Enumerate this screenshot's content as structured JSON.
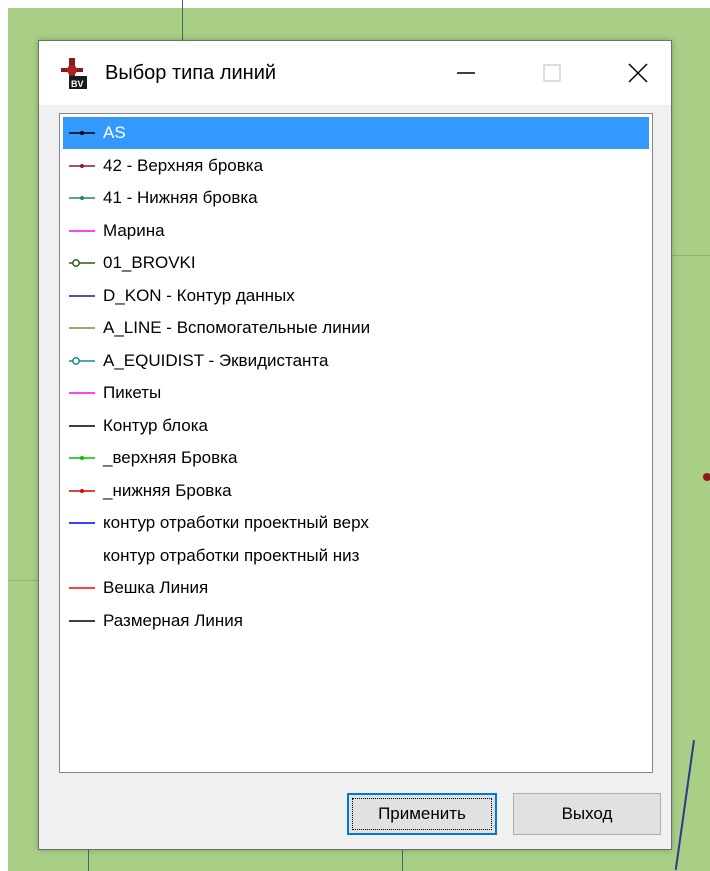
{
  "window": {
    "title": "Выбор типа линий",
    "app_icon_label": "BV"
  },
  "list": {
    "items": [
      {
        "label": "AS",
        "color": "#000000",
        "selected": true,
        "marker": "dot"
      },
      {
        "label": "42 - Верхняя бровка",
        "color": "#8b1a3a",
        "selected": false,
        "marker": "dot"
      },
      {
        "label": "41 - Нижняя бровка",
        "color": "#1a8a5a",
        "selected": false,
        "marker": "dot"
      },
      {
        "label": "Марина",
        "color": "#ff00ff",
        "selected": false,
        "marker": "none"
      },
      {
        "label": "01_BROVKI",
        "color": "#2e5d1e",
        "selected": false,
        "marker": "circle"
      },
      {
        "label": "D_KON - Контур данных",
        "color": "#1a1a8c",
        "selected": false,
        "marker": "none"
      },
      {
        "label": "A_LINE - Вспомогательные линии",
        "color": "#8a8a3a",
        "selected": false,
        "marker": "none"
      },
      {
        "label": "A_EQUIDIST - Эквидистанта",
        "color": "#1a8a8a",
        "selected": false,
        "marker": "circle"
      },
      {
        "label": "Пикеты",
        "color": "#ff00ff",
        "selected": false,
        "marker": "none"
      },
      {
        "label": "Контур блока",
        "color": "#000000",
        "selected": false,
        "marker": "none"
      },
      {
        "label": "_верхняя Бровка",
        "color": "#00c000",
        "selected": false,
        "marker": "dot"
      },
      {
        "label": "_нижняя Бровка",
        "color": "#e00000",
        "selected": false,
        "marker": "dot"
      },
      {
        "label": "контур отработки проектный верх",
        "color": "#0000ff",
        "selected": false,
        "marker": "none"
      },
      {
        "label": "контур отработки проектный низ",
        "color": "#ffffff",
        "selected": false,
        "marker": "none"
      },
      {
        "label": "Вешка Линия",
        "color": "#ff0000",
        "selected": false,
        "marker": "none"
      },
      {
        "label": "Размерная Линия",
        "color": "#000000",
        "selected": false,
        "marker": "none"
      }
    ]
  },
  "buttons": {
    "apply_label": "Применить",
    "exit_label": "Выход"
  },
  "colors": {
    "selection": "#3399ff",
    "workspace": "#a9cf86"
  }
}
